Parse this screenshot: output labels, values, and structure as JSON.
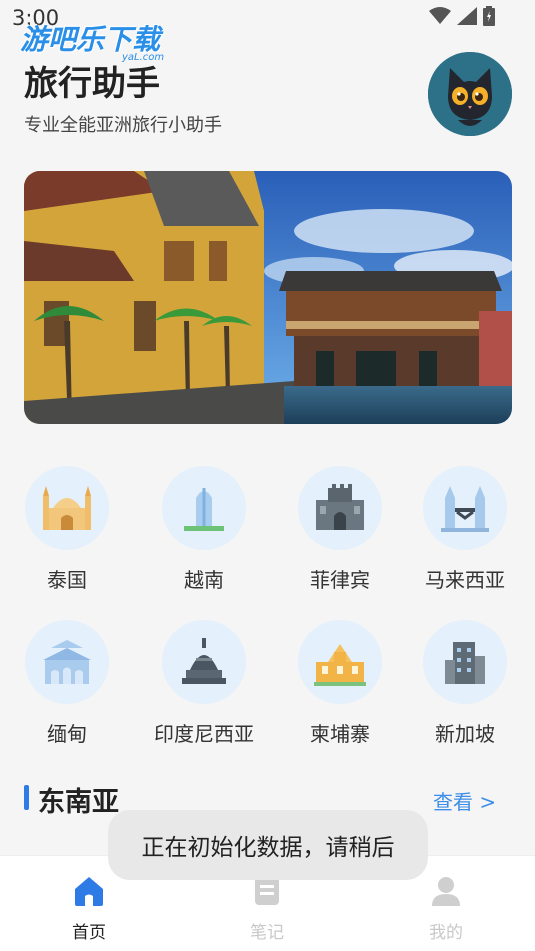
{
  "status_bar": {
    "time": "3:00"
  },
  "watermark": {
    "text": "游吧乐下载",
    "sub": "yaL.com"
  },
  "header": {
    "title": "旅行助手",
    "subtitle": "专业全能亚洲旅行小助手"
  },
  "countries": [
    {
      "label": "泰国",
      "icon": "temple-icon"
    },
    {
      "label": "越南",
      "icon": "tower-icon"
    },
    {
      "label": "菲律宾",
      "icon": "fortress-icon"
    },
    {
      "label": "马来西亚",
      "icon": "twin-towers-icon"
    },
    {
      "label": "缅甸",
      "icon": "palace-icon"
    },
    {
      "label": "印度尼西亚",
      "icon": "stupa-icon"
    },
    {
      "label": "柬埔寨",
      "icon": "angkor-icon"
    },
    {
      "label": "新加坡",
      "icon": "building-icon"
    }
  ],
  "section": {
    "title": "东南亚",
    "more": "查看 >"
  },
  "toast": {
    "text": "正在初始化数据，请稍后"
  },
  "tabs": [
    {
      "label": "首页",
      "active": true
    },
    {
      "label": "笔记",
      "active": false
    },
    {
      "label": "我的",
      "active": false
    }
  ],
  "colors": {
    "accent": "#2f7be6",
    "inactive": "#c8c8c8"
  }
}
